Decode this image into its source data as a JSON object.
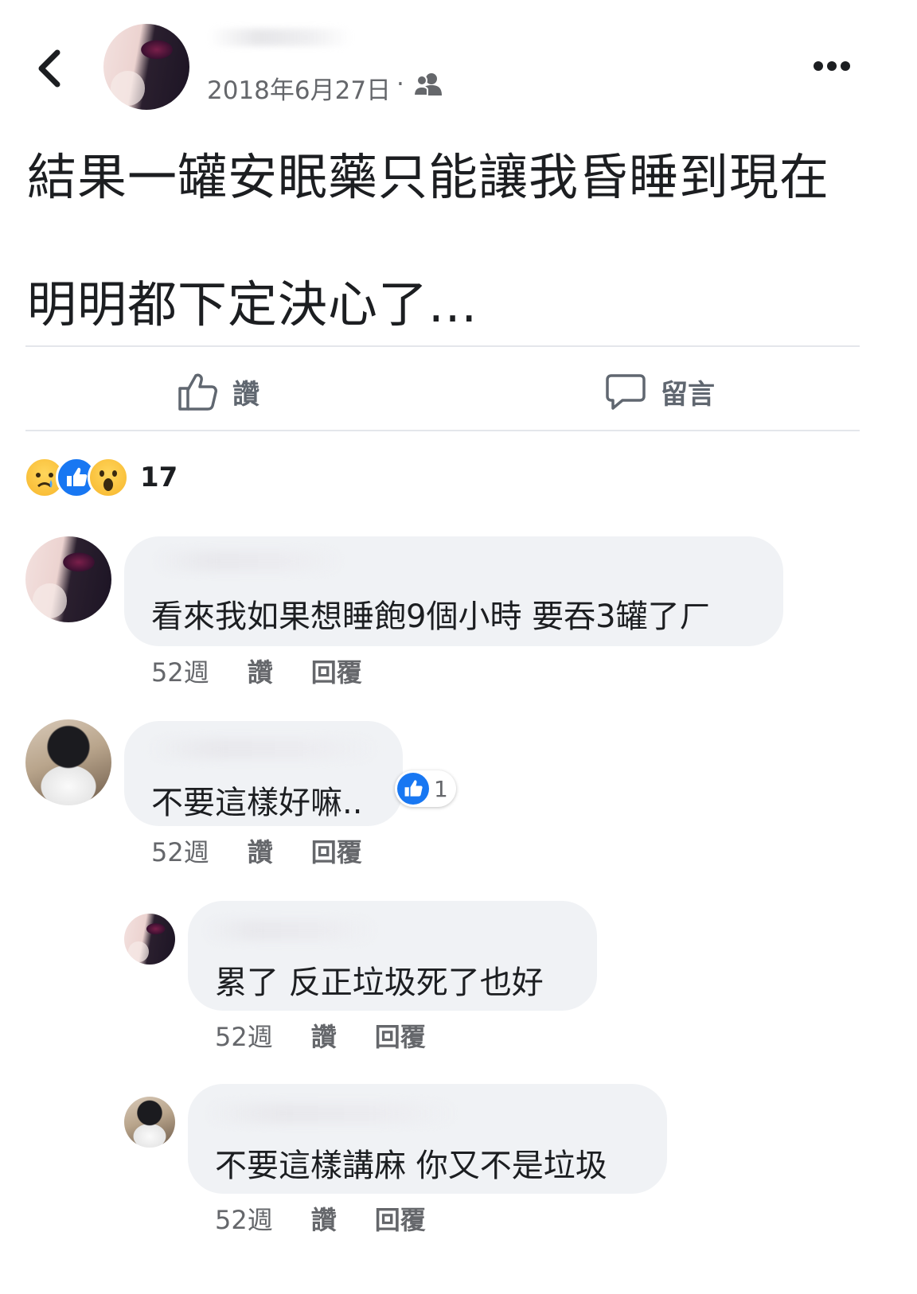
{
  "post": {
    "date": "2018年6月27日",
    "separator": "·",
    "privacy_icon": "friends-icon",
    "text_line1": "結果一罐安眠藥只能讓我昏睡到現在",
    "text_line2": "明明都下定決心了...",
    "like_label": "讚",
    "comment_label": "留言",
    "reactions": [
      "sad",
      "like",
      "wow"
    ],
    "reaction_count": "17"
  },
  "comments": [
    {
      "text": "看來我如果想睡飽9個小時 要吞3罐了ㄏ",
      "time": "52週",
      "like": "讚",
      "reply": "回覆"
    },
    {
      "text": "不要這樣好嘛..",
      "time": "52週",
      "like": "讚",
      "reply": "回覆",
      "reaction_count": "1"
    },
    {
      "text": "累了 反正垃圾死了也好",
      "time": "52週",
      "like": "讚",
      "reply": "回覆"
    },
    {
      "text": "不要這樣講麻 你又不是垃圾",
      "time": "52週",
      "like": "讚",
      "reply": "回覆"
    }
  ],
  "colors": {
    "accent": "#1877f2",
    "bubble": "#f0f2f5",
    "meta": "#65676b"
  }
}
